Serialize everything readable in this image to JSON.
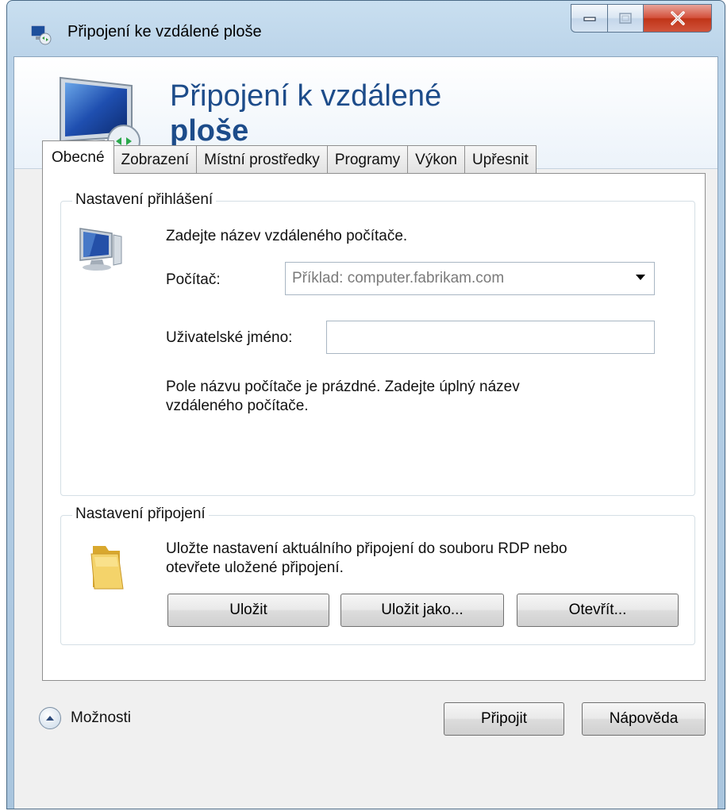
{
  "window": {
    "title": "Připojení ke vzdálené ploše"
  },
  "header": {
    "line1": "Připojení k vzdálené",
    "line2": "ploše"
  },
  "tabs": [
    {
      "label": "Obecné",
      "active": true
    },
    {
      "label": "Zobrazení",
      "active": false
    },
    {
      "label": "Místní prostředky",
      "active": false
    },
    {
      "label": "Programy",
      "active": false
    },
    {
      "label": "Výkon",
      "active": false
    },
    {
      "label": "Upřesnit",
      "active": false
    }
  ],
  "login": {
    "group_label": "Nastavení přihlášení",
    "instruction": "Zadejte název vzdáleného počítače.",
    "computer_label": "Počítač:",
    "computer_placeholder": "Příklad: computer.fabrikam.com",
    "username_label": "Uživatelské jméno:",
    "username_value": "",
    "warning_line1": "Pole názvu počítače je prázdné. Zadejte úplný název",
    "warning_line2": "vzdáleného počítače."
  },
  "connection": {
    "group_label": "Nastavení připojení",
    "description_line1": "Uložte nastavení aktuálního připojení do souboru RDP nebo",
    "description_line2": "otevřete uložené připojení.",
    "save_label": "Uložit",
    "save_as_label": "Uložit jako...",
    "open_label": "Otevřít..."
  },
  "footer": {
    "options_label": "Možnosti",
    "connect_label": "Připojit",
    "help_label": "Nápověda"
  }
}
